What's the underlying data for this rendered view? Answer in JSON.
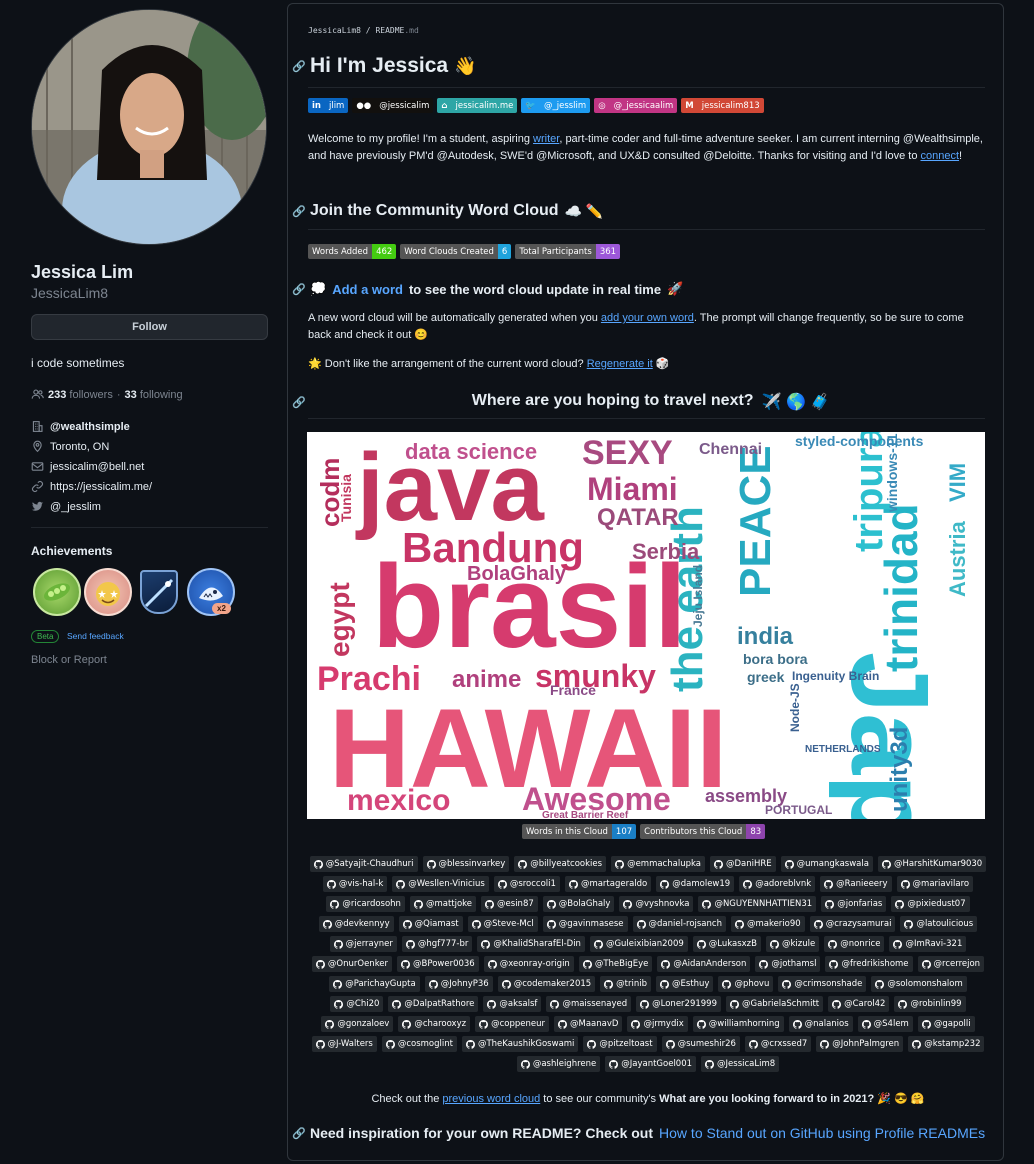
{
  "profile": {
    "name": "Jessica Lim",
    "login": "JessicaLim8",
    "follow_label": "Follow",
    "bio": "i code sometimes",
    "followers_count": "233",
    "followers_label": "followers",
    "dot": "·",
    "following_count": "33",
    "following_label": "following",
    "company": "@wealthsimple",
    "location": "Toronto, ON",
    "email": "jessicalim@bell.net",
    "website": "https://jessicalim.me/",
    "twitter": "@_jesslim",
    "achievements_title": "Achievements",
    "achievement_multiplier": "x2",
    "beta_label": "Beta",
    "feedback_label": "Send feedback",
    "block_label": "Block or Report"
  },
  "readme": {
    "breadcrumb_user": "JessicaLim8",
    "breadcrumb_sep": " / ",
    "breadcrumb_file": "README",
    "breadcrumb_ext": ".md",
    "title": "Hi I'm Jessica",
    "title_emoji": "👋",
    "socials": [
      {
        "label": "jlim",
        "color": "#0a66c2",
        "icon": "in"
      },
      {
        "label": "@jessicalim",
        "color": "#12100e",
        "icon": "●●"
      },
      {
        "label": "jessicalim.me",
        "color": "#2ea6a6",
        "icon": "⌂"
      },
      {
        "label": "@_jesslim",
        "color": "#1d9bf0",
        "icon": "🐦"
      },
      {
        "label": "@_jessicaalim",
        "color": "#c13584",
        "icon": "◎"
      },
      {
        "label": "jessicalim813",
        "color": "#d14836",
        "icon": "M"
      }
    ],
    "intro_pre": "Welcome to my profile! I'm a student, aspiring ",
    "intro_link1": "writer",
    "intro_mid": ", part-time coder and full-time adventure seeker. I am current interning @Wealthsimple, and have previously PM'd @Autodesk, SWE'd @Microsoft, and UX&D consulted @Deloitte. Thanks for visiting and I'd love to ",
    "intro_link2": "connect",
    "intro_end": "!",
    "wc_title": "Join the Community Word Cloud",
    "wc_title_emoji": "☁️ ✏️",
    "stats": [
      {
        "label": "Words Added",
        "value": "462",
        "color": "#4c1"
      },
      {
        "label": "Word Clouds Created",
        "value": "6",
        "color": "#1fa3dc"
      },
      {
        "label": "Total Participants",
        "value": "361",
        "color": "#9d58d9"
      }
    ],
    "add_emoji": "💭",
    "add_link": "Add a word",
    "add_rest": "to see the word cloud update in real time",
    "add_emoji2": "🚀",
    "gen_pre": "A new word cloud will be automatically generated when you ",
    "gen_link": "add your own word",
    "gen_post": ". The prompt will change frequently, so be sure to come back and check it out ",
    "gen_emoji": "😊",
    "regen_emoji": "🌟",
    "regen_pre": " Don't like the arrangement of the current word cloud? ",
    "regen_link": "Regenerate it",
    "regen_emoji2": "🎲",
    "prompt": "Where are you hoping to travel next?",
    "prompt_emoji": "✈️ 🌎 🧳",
    "cloud_stats": [
      {
        "label": "Words in this Cloud",
        "value": "107",
        "color": "#1a7fc6"
      },
      {
        "label": "Contributors this Cloud",
        "value": "83",
        "color": "#8e44ad"
      }
    ],
    "contributors": [
      "@Satyajit-Chaudhuri",
      "@blessinvarkey",
      "@billyeatcookies",
      "@emmachalupka",
      "@DaniHRE",
      "@umangkaswala",
      "@HarshitKumar9030",
      "@vis-hal-k",
      "@Wesllen-Vinicius",
      "@sroccoli1",
      "@martageraldo",
      "@damolew19",
      "@adoreblvnk",
      "@Ranieeery",
      "@mariavilaro",
      "@ricardosohn",
      "@mattjoke",
      "@esin87",
      "@BolaGhaly",
      "@vyshnovka",
      "@NGUYENNHATTIEN31",
      "@jonfarias",
      "@pixiedust07",
      "@devkennyy",
      "@Qiamast",
      "@Steve-Mcl",
      "@gavinmasese",
      "@daniel-rojsanch",
      "@makerio90",
      "@crazysamurai",
      "@latoulicious",
      "@jerrayner",
      "@hgf777-br",
      "@KhalidSharafEl-Din",
      "@Guleixibian2009",
      "@LukasxzB",
      "@kizule",
      "@nonrice",
      "@ImRavi-321",
      "@OnurOenker",
      "@BPower0036",
      "@xeonray-origin",
      "@TheBigEye",
      "@AidanAnderson",
      "@jothamsl",
      "@fredrikishome",
      "@rcerrejon",
      "@ParichayGupta",
      "@JohnyP36",
      "@codemaker2015",
      "@trinib",
      "@Esthuy",
      "@phovu",
      "@crimsonshade",
      "@solomonshalom",
      "@Chi20",
      "@DalpatRathore",
      "@aksalsf",
      "@maissenayed",
      "@Loner291999",
      "@GabrielaSchmitt",
      "@Carol42",
      "@robinlin99",
      "@gonzaloev",
      "@charooxyz",
      "@coppeneur",
      "@MaanavD",
      "@jrmydix",
      "@williamhorning",
      "@nalanios",
      "@S4lem",
      "@gapolli",
      "@J-Walters",
      "@cosmoglint",
      "@TheKaushikGoswami",
      "@pitzeltoast",
      "@sumeshir26",
      "@crxssed7",
      "@JohnPalmgren",
      "@kstamp232",
      "@ashleighrene",
      "@JayantGoel001",
      "@JessicaLim8"
    ],
    "prev_pre": "Check out the ",
    "prev_link": "previous word cloud",
    "prev_mid": " to see our community's ",
    "prev_bold": "What are you looking forward to in 2021?",
    "prev_emoji": "🎉 😎 🤗",
    "insp_text": "Need inspiration for your own README? Check out",
    "insp_link": "How to Stand out on GitHub using Profile READMEs"
  },
  "word_cloud": {
    "words": [
      {
        "t": "java",
        "c": "#c2375f"
      },
      {
        "t": "brasil",
        "c": "#d63b6e"
      },
      {
        "t": "HAWAII",
        "c": "#e65579"
      },
      {
        "t": "Japan",
        "c": "#2fbfd3"
      },
      {
        "t": "Bandung",
        "c": "#c83466"
      },
      {
        "t": "trinidad",
        "c": "#24b4c7"
      },
      {
        "t": "tripura",
        "c": "#2cc0cf"
      },
      {
        "t": "the earth",
        "c": "#2bb3c0"
      },
      {
        "t": "PEACE",
        "c": "#26a9c0"
      },
      {
        "t": "Prachi",
        "c": "#d63b6e"
      },
      {
        "t": "smunky",
        "c": "#c83466"
      },
      {
        "t": "mexico",
        "c": "#d4457a"
      },
      {
        "t": "Awesome",
        "c": "#c0508d"
      },
      {
        "t": "data science",
        "c": "#c0508d"
      },
      {
        "t": "SEXY",
        "c": "#a84a80"
      },
      {
        "t": "Miami",
        "c": "#b0407d"
      },
      {
        "t": "QATAR",
        "c": "#9b4a7a"
      },
      {
        "t": "Serbia",
        "c": "#9b4a7a"
      },
      {
        "t": "BolaGhaly",
        "c": "#b0407d"
      },
      {
        "t": "egypt",
        "c": "#c2375f"
      },
      {
        "t": "codm",
        "c": "#b42e5c"
      },
      {
        "t": "anime",
        "c": "#b0407d"
      },
      {
        "t": "india",
        "c": "#36809e"
      },
      {
        "t": "unity3d",
        "c": "#2b7fae"
      },
      {
        "t": "Austria",
        "c": "#3fb9c7"
      },
      {
        "t": "VIM",
        "c": "#34aac8"
      },
      {
        "t": "assembly",
        "c": "#8a4a86"
      },
      {
        "t": "Chennai",
        "c": "#7b5a8a"
      },
      {
        "t": "styled-components",
        "c": "#3a8ab6"
      },
      {
        "t": "Tunisia",
        "c": "#c2375f"
      },
      {
        "t": "bora bora",
        "c": "#3c6e88"
      },
      {
        "t": "greek",
        "c": "#3c6e88"
      },
      {
        "t": "Ingenuity Brain",
        "c": "#3a6090"
      },
      {
        "t": "Jeju Island",
        "c": "#4a7a94"
      },
      {
        "t": "France",
        "c": "#8a4a86"
      },
      {
        "t": "windows-11",
        "c": "#3a8ab6"
      },
      {
        "t": "NETHERLANDS",
        "c": "#3a6090"
      },
      {
        "t": "PORTUGAL",
        "c": "#7b5a8a"
      },
      {
        "t": "Node-JS",
        "c": "#3a6090"
      },
      {
        "t": "Great Barrier Reef",
        "c": "#a84a80"
      }
    ]
  }
}
